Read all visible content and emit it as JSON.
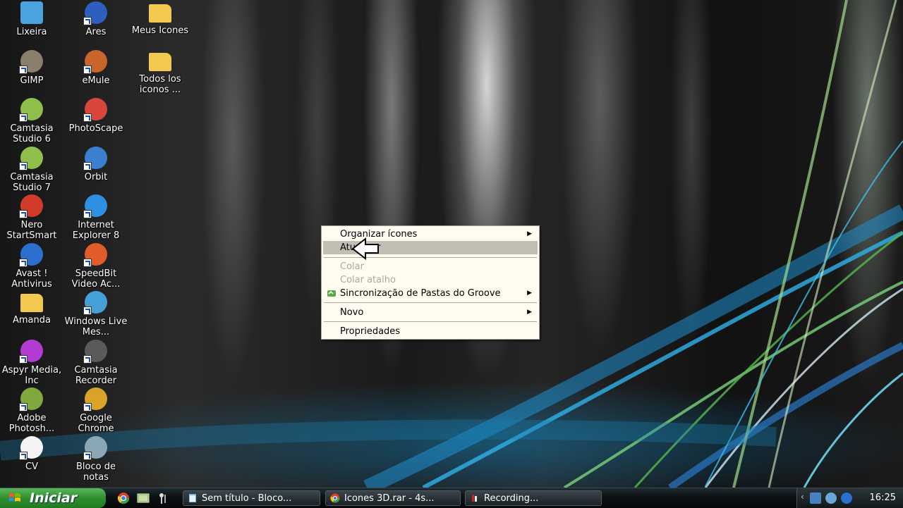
{
  "desktop": {
    "icons": [
      {
        "label": "Lixeira",
        "icon": "recycle-bin-icon",
        "color": "#4aa3df"
      },
      {
        "label": "Ares",
        "icon": "ares-icon",
        "color": "#2e5fbf"
      },
      {
        "label": "Meus Icones",
        "icon": "folder-icon",
        "color": "#f2c94c"
      },
      {
        "label": "GIMP",
        "icon": "gimp-icon",
        "color": "#8a7f6b"
      },
      {
        "label": "eMule",
        "icon": "emule-icon",
        "color": "#c8652a"
      },
      {
        "label": "Todos los iconos ...",
        "icon": "folder-icon",
        "color": "#f2c94c"
      },
      {
        "label": "Camtasia Studio 6",
        "icon": "camtasia-icon",
        "color": "#8dbf4a"
      },
      {
        "label": "PhotoScape",
        "icon": "photoscape-icon",
        "color": "#d9473c"
      },
      {
        "label": "Camtasia Studio 7",
        "icon": "camtasia-icon",
        "color": "#8dbf4a"
      },
      {
        "label": "Orbit",
        "icon": "orbit-icon",
        "color": "#3c7fd1"
      },
      {
        "label": "Nero StartSmart",
        "icon": "nero-icon",
        "color": "#d23a2a"
      },
      {
        "label": "Internet Explorer 8",
        "icon": "internet-explorer-icon",
        "color": "#2f8fe0"
      },
      {
        "label": "Avast ! Antivirus",
        "icon": "avast-icon",
        "color": "#2d6fcf"
      },
      {
        "label": "SpeedBit Video Ac...",
        "icon": "speedbit-icon",
        "color": "#e25b2b"
      },
      {
        "label": "Amanda",
        "icon": "folder-icon",
        "color": "#f2c94c"
      },
      {
        "label": "Windows Live Mes...",
        "icon": "messenger-icon",
        "color": "#45a0d8"
      },
      {
        "label": "Aspyr Media, Inc",
        "icon": "aspyr-icon",
        "color": "#b43bd1"
      },
      {
        "label": "Camtasia Recorder",
        "icon": "camcorder-icon",
        "color": "#5a5a5a"
      },
      {
        "label": "Adobe Photosh...",
        "icon": "photoshop-icon",
        "color": "#7fa93e"
      },
      {
        "label": "Google Chrome",
        "icon": "chrome-icon",
        "color": "#d9a32a"
      },
      {
        "label": "CV",
        "icon": "document-icon",
        "color": "#f4f4f4"
      },
      {
        "label": "Bloco de notas",
        "icon": "notepad-icon",
        "color": "#8aa7b5"
      }
    ]
  },
  "context_menu": {
    "items": [
      {
        "label": "Organizar ícones",
        "submenu": true,
        "disabled": false
      },
      {
        "label": "Atualizar",
        "submenu": false,
        "disabled": false,
        "highlighted": true
      },
      {
        "label": "Colar",
        "submenu": false,
        "disabled": true
      },
      {
        "label": "Colar atalho",
        "submenu": false,
        "disabled": true
      },
      {
        "label": "Sincronização de Pastas do Groove",
        "submenu": true,
        "disabled": false
      },
      {
        "label": "Novo",
        "submenu": true,
        "disabled": false
      },
      {
        "label": "Propriedades",
        "submenu": false,
        "disabled": false
      }
    ]
  },
  "taskbar": {
    "start_label": "Iniciar",
    "tasks": [
      {
        "label": "Sem título - Bloco...",
        "icon": "notepad-icon"
      },
      {
        "label": "Icones 3D.rar - 4s...",
        "icon": "chrome-icon"
      },
      {
        "label": "Recording...",
        "icon": "recording-icon"
      }
    ],
    "clock": "16:25"
  }
}
